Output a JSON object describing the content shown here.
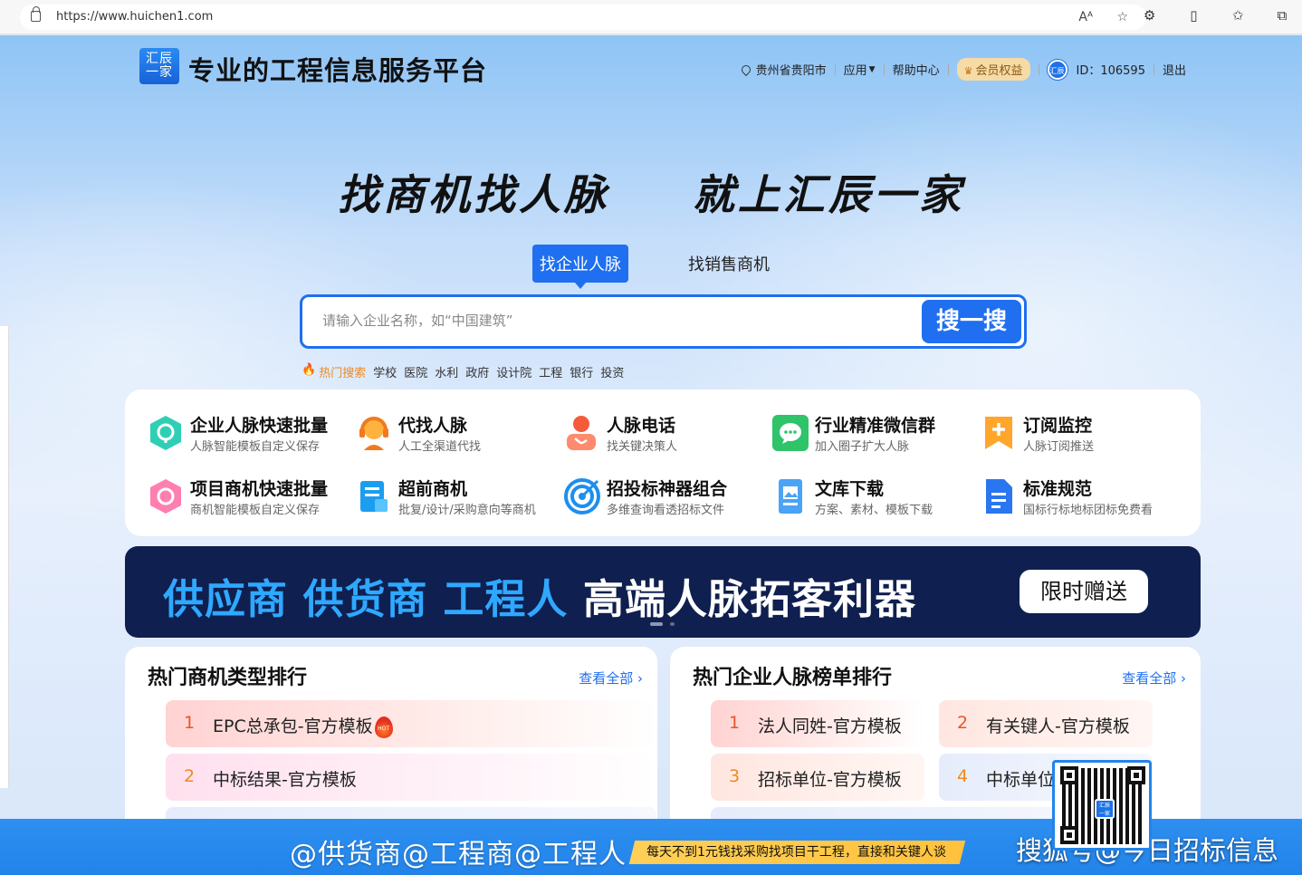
{
  "browser": {
    "url": "https://www.huichen1.com",
    "read_aloud_label": "Aᴬ",
    "favorite_icon": "star-icon"
  },
  "header": {
    "logo_line1": "汇辰",
    "logo_line2": "一家",
    "title": "专业的工程信息服务平台",
    "location": "贵州省贵阳市",
    "app_menu": "应用",
    "help": "帮助中心",
    "vip": "会员权益",
    "avatar_text": "汇辰",
    "user_id": "ID：106595",
    "logout": "退出"
  },
  "hero": {
    "slogan_left": "找商机找人脉",
    "slogan_right": "就上汇辰一家",
    "tabs": [
      "找企业人脉",
      "找销售商机"
    ],
    "search_placeholder": "请输入企业名称，如“中国建筑”",
    "search_button": "搜一搜",
    "hot_label": "热门搜索",
    "hot_keywords": [
      "学校",
      "医院",
      "水利",
      "政府",
      "设计院",
      "工程",
      "银行",
      "投资"
    ]
  },
  "features": [
    {
      "title": "企业人脉快速批量",
      "sub": "人脉智能模板自定义保存",
      "icon": "hexagon-teal-icon"
    },
    {
      "title": "代找人脉",
      "sub": "人工全渠道代找",
      "icon": "headset-agent-icon"
    },
    {
      "title": "人脉电话",
      "sub": "找关键决策人",
      "icon": "phone-contact-icon"
    },
    {
      "title": "行业精准微信群",
      "sub": "加入圈子扩大人脉",
      "icon": "wechat-icon"
    },
    {
      "title": "订阅监控",
      "sub": "人脉订阅推送",
      "icon": "bookmark-plus-icon"
    },
    {
      "title": "项目商机快速批量",
      "sub": "商机智能模板自定义保存",
      "icon": "hexagon-pink-icon"
    },
    {
      "title": "超前商机",
      "sub": "批复/设计/采购意向等商机",
      "icon": "document-building-icon"
    },
    {
      "title": "招投标神器组合",
      "sub": "多维查询看透招标文件",
      "icon": "target-icon"
    },
    {
      "title": "文库下载",
      "sub": "方案、素材、模板下载",
      "icon": "file-library-icon"
    },
    {
      "title": "标准规范",
      "sub": "国标行标地标团标免费看",
      "icon": "document-standard-icon"
    }
  ],
  "banner": {
    "highlight": "供应商 供货商 工程人",
    "text": "高端人脉拓客利器",
    "button": "限时赠送"
  },
  "ranking_left": {
    "title": "热门商机类型排行",
    "more": "查看全部",
    "items": [
      {
        "rank": "1",
        "label": "EPC总承包-官方模板",
        "badge": "HOT"
      },
      {
        "rank": "2",
        "label": "中标结果-官方模板"
      }
    ]
  },
  "ranking_right": {
    "title": "热门企业人脉榜单排行",
    "more": "查看全部",
    "items": [
      {
        "rank": "1",
        "label": "法人同姓-官方模板"
      },
      {
        "rank": "2",
        "label": "有关键人-官方模板"
      },
      {
        "rank": "3",
        "label": "招标单位-官方模板"
      },
      {
        "rank": "4",
        "label": "中标单位"
      }
    ]
  },
  "overlay": {
    "tagline": "@供货商@工程商@工程人",
    "slogan": "每天不到1元钱找采购找项目干工程，直接和关键人谈",
    "watermark": "搜狐号@今日招标信息",
    "qr_logo": "汇辰 一家"
  }
}
